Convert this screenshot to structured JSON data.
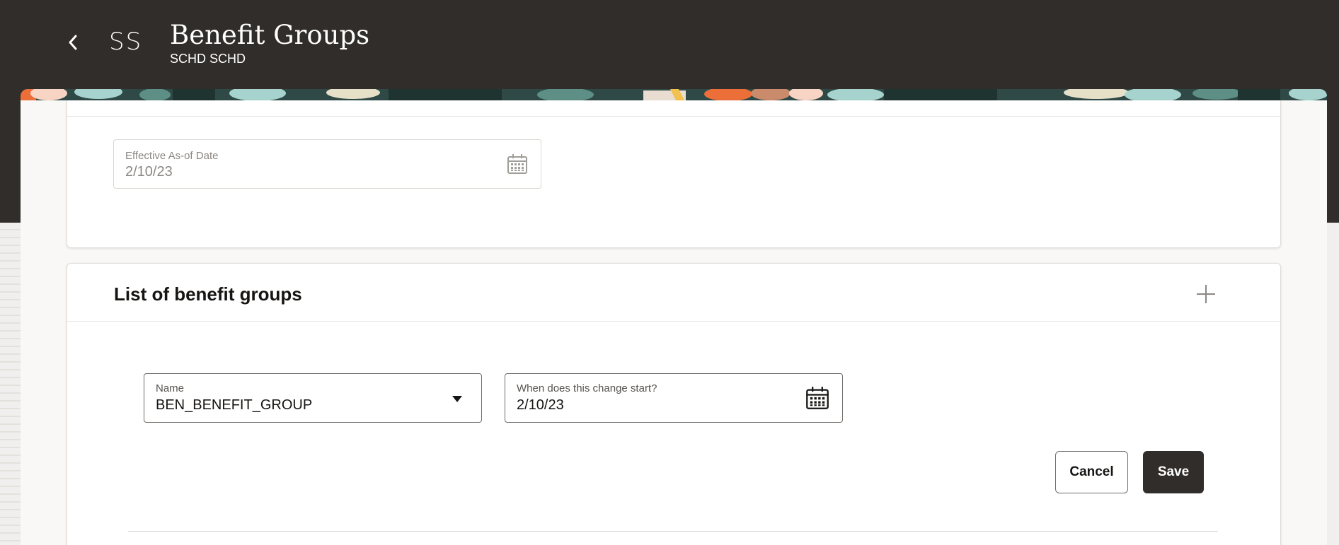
{
  "header": {
    "back_icon": "chevron-left-icon",
    "avatar_initials": "SS",
    "title": "Benefit Groups",
    "subtitle": "SCHD SCHD"
  },
  "effective_date": {
    "label": "Effective As-of Date",
    "value": "2/10/23",
    "icon": "calendar-icon"
  },
  "benefit_groups": {
    "title": "List of benefit groups",
    "add_icon": "plus-icon",
    "form": {
      "name_label": "Name",
      "name_value": "BEN_BENEFIT_GROUP",
      "name_icon": "caret-down-icon",
      "start_label": "When does this change start?",
      "start_value": "2/10/23",
      "start_icon": "calendar-icon",
      "cancel_label": "Cancel",
      "save_label": "Save"
    }
  },
  "colors": {
    "header_bg": "#312d2a",
    "page_bg": "#f1efed",
    "panel_bg": "#f9f8f6",
    "primary_button": "#312d2a",
    "banner_orange": "#ec6f3a",
    "banner_teal": "#2f4a46",
    "banner_mint": "#a7d3cf"
  }
}
